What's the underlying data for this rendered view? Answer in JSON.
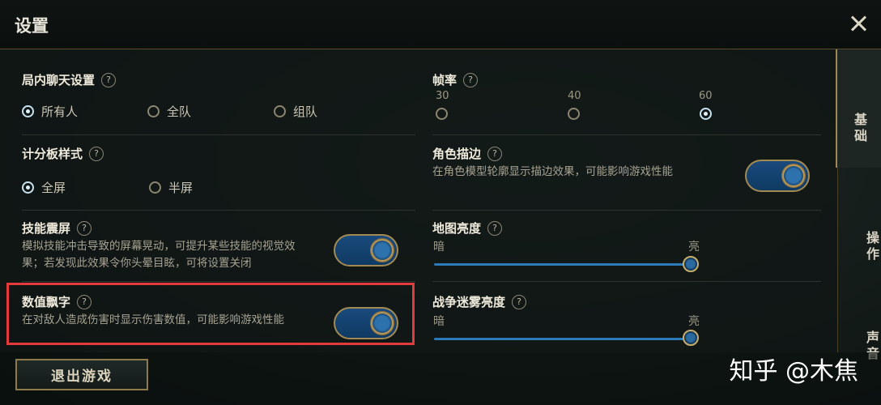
{
  "window": {
    "title": "设置"
  },
  "side_tabs": [
    {
      "label": "基础",
      "active": true
    },
    {
      "label": "操作",
      "active": false
    },
    {
      "label": "声音",
      "active": false
    }
  ],
  "chat": {
    "label": "局内聊天设置",
    "options": [
      "所有人",
      "全队",
      "组队"
    ],
    "selected": "所有人"
  },
  "scoreboard": {
    "label": "计分板样式",
    "options": [
      "全屏",
      "半屏"
    ],
    "selected": "全屏"
  },
  "skill_shake": {
    "label": "技能震屏",
    "desc1": "模拟技能冲击导致的屏幕晃动，可提升某些技能的视觉效",
    "desc2": "果；若发现此效果令你头晕目眩，可将设置关闭",
    "enabled": true
  },
  "damage_numbers": {
    "label": "数值飘字",
    "desc": "在对敌人造成伤害时显示伤害数值，可能影响游戏性能",
    "enabled": true
  },
  "fps": {
    "label": "帧率",
    "options": [
      "30",
      "40",
      "60"
    ],
    "selected": "60"
  },
  "outline": {
    "label": "角色描边",
    "desc": "在角色模型轮廓显示描边效果，可能影响游戏性能",
    "enabled": true
  },
  "map_brightness": {
    "label": "地图亮度",
    "min_label": "暗",
    "max_label": "亮",
    "value_pct": 100
  },
  "fog_brightness": {
    "label": "战争迷雾亮度",
    "min_label": "暗",
    "max_label": "亮"
  },
  "help_glyph": "?",
  "footer": {
    "exit_label": "退出游戏"
  },
  "watermark": "知乎 @木焦"
}
